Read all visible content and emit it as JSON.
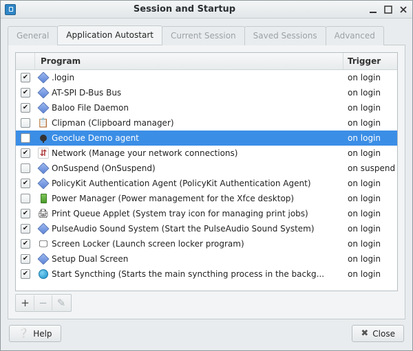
{
  "window": {
    "title": "Session and Startup"
  },
  "tabs": [
    {
      "label": "General",
      "active": false
    },
    {
      "label": "Application Autostart",
      "active": true
    },
    {
      "label": "Current Session",
      "active": false
    },
    {
      "label": "Saved Sessions",
      "active": false
    },
    {
      "label": "Advanced",
      "active": false
    }
  ],
  "columns": {
    "program": "Program",
    "trigger": "Trigger"
  },
  "rows": [
    {
      "checked": true,
      "icon": "diamond",
      "label": ".login",
      "trigger": "on login",
      "selected": false
    },
    {
      "checked": true,
      "icon": "diamond",
      "label": "AT-SPI D-Bus Bus",
      "trigger": "on login",
      "selected": false
    },
    {
      "checked": true,
      "icon": "diamond",
      "label": "Baloo File Daemon",
      "trigger": "on login",
      "selected": false
    },
    {
      "checked": false,
      "icon": "clipboard",
      "label": "Clipman (Clipboard manager)",
      "trigger": "on login",
      "selected": false
    },
    {
      "checked": false,
      "icon": "pin",
      "label": "Geoclue Demo agent",
      "trigger": "on login",
      "selected": true
    },
    {
      "checked": true,
      "icon": "network",
      "label": "Network (Manage your network connections)",
      "trigger": "on login",
      "selected": false
    },
    {
      "checked": false,
      "icon": "diamond",
      "label": "OnSuspend (OnSuspend)",
      "trigger": "on suspend",
      "selected": false
    },
    {
      "checked": true,
      "icon": "diamond",
      "label": "PolicyKit Authentication Agent (PolicyKit Authentication Agent)",
      "trigger": "on login",
      "selected": false
    },
    {
      "checked": false,
      "icon": "battery",
      "label": "Power Manager (Power management for the Xfce desktop)",
      "trigger": "on login",
      "selected": false
    },
    {
      "checked": true,
      "icon": "printer",
      "label": "Print Queue Applet (System tray icon for managing print jobs)",
      "trigger": "on login",
      "selected": false
    },
    {
      "checked": true,
      "icon": "diamond",
      "label": "PulseAudio Sound System (Start the PulseAudio Sound System)",
      "trigger": "on login",
      "selected": false
    },
    {
      "checked": true,
      "icon": "screen",
      "label": "Screen Locker (Launch screen locker program)",
      "trigger": "on login",
      "selected": false
    },
    {
      "checked": true,
      "icon": "diamond",
      "label": "Setup Dual Screen",
      "trigger": "on login",
      "selected": false
    },
    {
      "checked": true,
      "icon": "sync",
      "label": "Start Syncthing (Starts the main syncthing process in the backg...",
      "trigger": "on login",
      "selected": false
    }
  ],
  "toolbar": {
    "add": "+",
    "remove": "−",
    "edit": "✎"
  },
  "buttons": {
    "help": "Help",
    "close": "Close"
  }
}
